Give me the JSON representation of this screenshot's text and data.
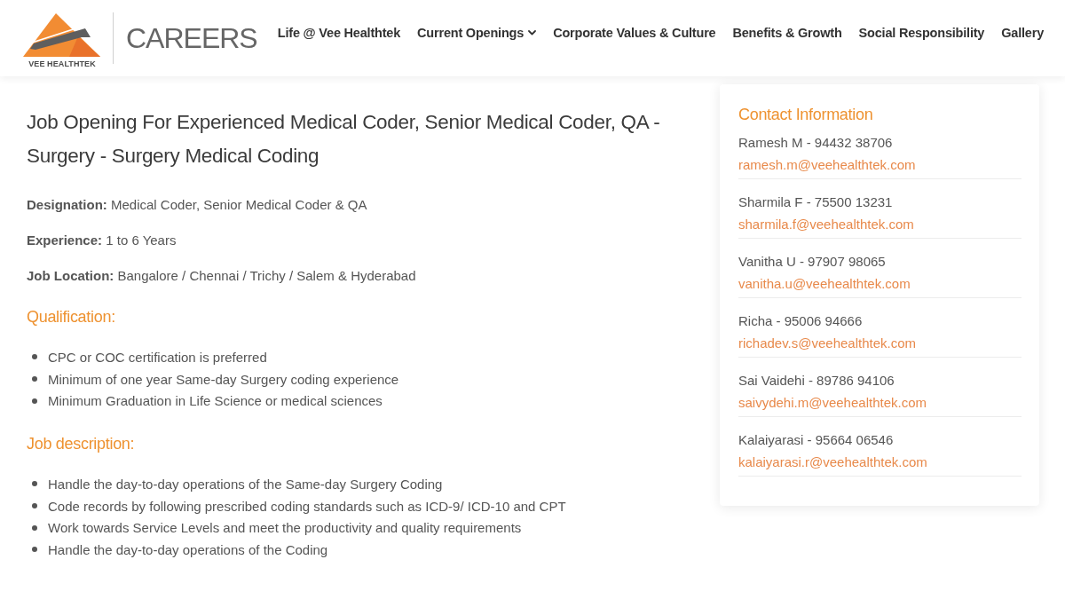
{
  "header": {
    "brand_name": "VEE HEALTHTEK",
    "section_title": "CAREERS",
    "nav": [
      {
        "label": "Life @ Vee Healthtek",
        "dropdown": false
      },
      {
        "label": "Current Openings",
        "dropdown": true
      },
      {
        "label": "Corporate Values & Culture",
        "dropdown": false
      },
      {
        "label": "Benefits & Growth",
        "dropdown": false
      },
      {
        "label": "Social Responsibility",
        "dropdown": false
      },
      {
        "label": "Gallery",
        "dropdown": false
      }
    ]
  },
  "job": {
    "title": "Job Opening For Experienced Medical Coder, Senior Medical Coder, QA - Surgery - Surgery Medical Coding",
    "details": [
      "**Designation:** Medical Coder, Senior Medical Coder & QA",
      "**Experience:** 1 to 6 Years",
      "**Job Location:** Bangalore / Chennai / Trichy / Salem & Hyderabad"
    ],
    "sections": [
      {
        "heading": "Qualification:",
        "items": [
          "CPC or COC certification is preferred",
          "Minimum of one year Same-day Surgery coding experience",
          "Minimum Graduation in Life Science or medical sciences"
        ]
      },
      {
        "heading": "Job description:",
        "items": [
          "Handle the day-to-day operations of the Same-day Surgery Coding",
          "Code records by following prescribed coding standards such as ICD-9/ ICD-10 and CPT",
          "Work towards Service Levels and meet the productivity and quality requirements",
          "Handle the day-to-day operations of the Coding"
        ]
      }
    ]
  },
  "contact": {
    "heading": "Contact Information",
    "people": [
      {
        "name_phone": "Ramesh M - 94432 38706",
        "email": "ramesh.m@veehealthtek.com"
      },
      {
        "name_phone": "Sharmila F - 75500 13231",
        "email": "sharmila.f@veehealthtek.com"
      },
      {
        "name_phone": "Vanitha U - 97907 98065",
        "email": "vanitha.u@veehealthtek.com"
      },
      {
        "name_phone": "Richa - 95006 94666",
        "email": "richadev.s@veehealthtek.com"
      },
      {
        "name_phone": "Sai Vaidehi - 89786 94106",
        "email": "saivydehi.m@veehealthtek.com"
      },
      {
        "name_phone": "Kalaiyarasi - 95664 06546",
        "email": "kalaiyarasi.r@veehealthtek.com"
      }
    ]
  }
}
